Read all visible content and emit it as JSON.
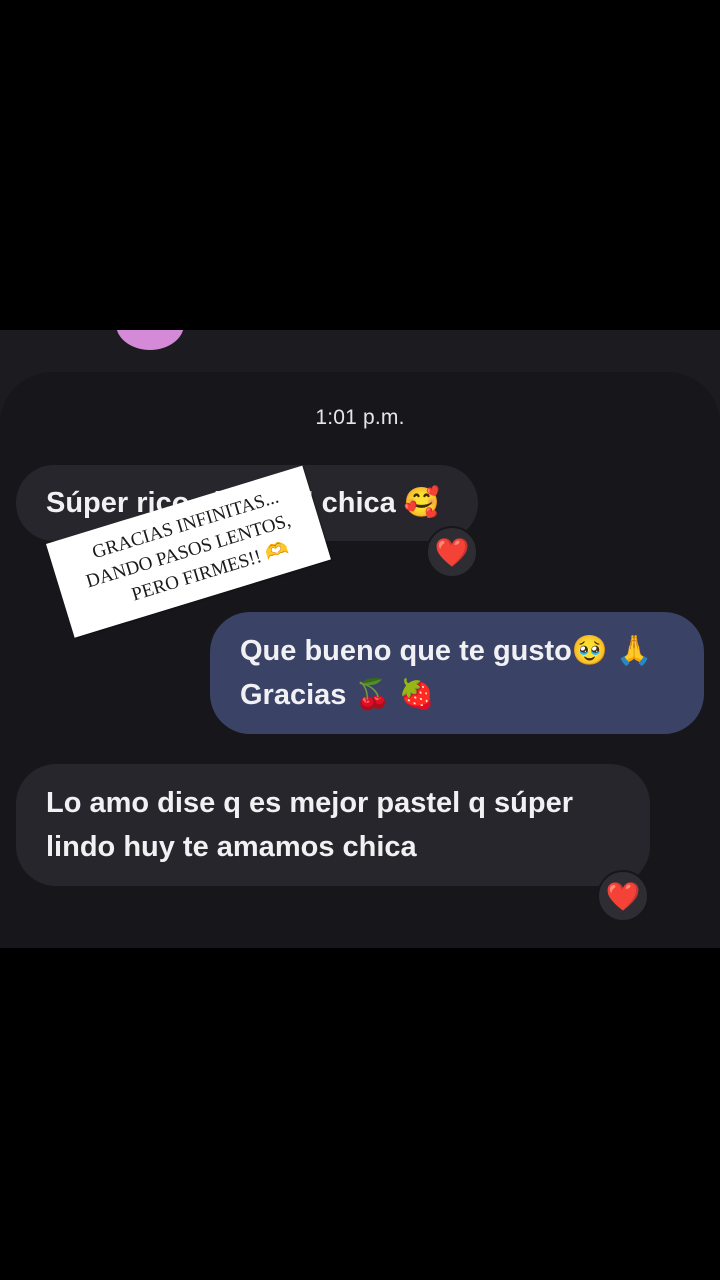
{
  "chat": {
    "timestamp": "1:01 p.m.",
    "messages": [
      {
        "direction": "incoming",
        "text": "Súper rico el pastel chica",
        "emoji": "🥰",
        "reaction": "❤️"
      },
      {
        "direction": "outgoing",
        "line1": "Que bueno que te gusto",
        "line1_emoji": "🥹 🙏",
        "line2": "Gracias",
        "line2_emoji": "🍒 🍓"
      },
      {
        "direction": "incoming",
        "line1": "Lo amo dise q es mejor pastel q súper",
        "line2": "lindo huy te amamos chica",
        "reaction": "❤️"
      }
    ]
  },
  "sticker": {
    "line1": "GRACIAS INFINITAS...",
    "line2": "DANDO PASOS LENTOS,",
    "line3": "PERO FIRMES!!",
    "emoji": "🫶"
  },
  "colors": {
    "background": "#000000",
    "chat_background": "#16161b",
    "incoming_bubble": "#26262c",
    "outgoing_bubble": "#3a4266",
    "avatar": "#d58ad8",
    "reaction_heart": "#e0162b"
  }
}
